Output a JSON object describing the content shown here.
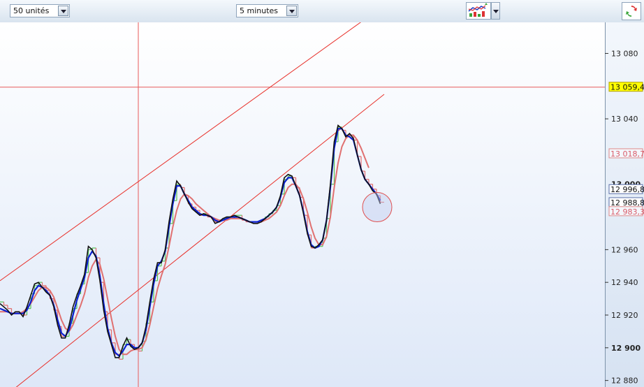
{
  "toolbar": {
    "units_select": "50 unités",
    "interval_select": "5 minutes",
    "tool_icon": "chart-tools-icon",
    "corner_icon": "refresh-arrows-icon"
  },
  "colors": {
    "up_bar": "#55c255",
    "down_bar": "#e06a6a",
    "fast_ma": "#0a1fd0",
    "price_line": "#111111",
    "slow_ma": "#e07070",
    "trendline": "#e8302a",
    "crosshair": "#e85a5a",
    "price_highlight": "#ffff00"
  },
  "chart_data": {
    "type": "line",
    "instrument_units": "50 unités",
    "interval": "5 minutes",
    "ylim": [
      12876,
      13099
    ],
    "y_ticks": [
      {
        "value": 13080,
        "label": "13 080",
        "major": false
      },
      {
        "value": 13040,
        "label": "13 040",
        "major": false
      },
      {
        "value": 12960,
        "label": "12 960",
        "major": false
      },
      {
        "value": 12940,
        "label": "12 940",
        "major": false
      },
      {
        "value": 12920,
        "label": "12 920",
        "major": false
      },
      {
        "value": 12900,
        "label": "12 900",
        "major": true
      },
      {
        "value": 12880,
        "label": "12 880",
        "major": false
      }
    ],
    "partial_tick": {
      "value": 13000,
      "label": "13 000"
    },
    "price_tags": [
      {
        "value": 13059.4,
        "label": "13 059,4",
        "style": "highlight"
      },
      {
        "value": 13018.7,
        "label": "13 018,7",
        "style": "pink"
      },
      {
        "value": 12996.8,
        "label": "12 996,8",
        "style": "blue"
      },
      {
        "value": 12988.8,
        "label": "12 988,8",
        "style": "blue"
      },
      {
        "value": 12983.3,
        "label": "12 983,3",
        "style": "pink"
      }
    ],
    "crosshair": {
      "bar": 36,
      "value": 13059.4
    },
    "price_series": [
      12927,
      12925,
      12923,
      12920,
      12922,
      12922,
      12919,
      12925,
      12932,
      12939,
      12940,
      12937,
      12934,
      12932,
      12925,
      12914,
      12906,
      12906,
      12914,
      12925,
      12932,
      12938,
      12945,
      12962,
      12960,
      12955,
      12941,
      12923,
      12910,
      12902,
      12894,
      12894,
      12901,
      12906,
      12901,
      12899,
      12900,
      12903,
      12913,
      12928,
      12942,
      12952,
      12952,
      12960,
      12977,
      12991,
      13002,
      12999,
      12994,
      12989,
      12985,
      12983,
      12981,
      12982,
      12981,
      12980,
      12976,
      12977,
      12979,
      12980,
      12980,
      12981,
      12980,
      12979,
      12978,
      12977,
      12976,
      12976,
      12977,
      12979,
      12981,
      12983,
      12986,
      12993,
      13004,
      13006,
      13005,
      12999,
      12993,
      12982,
      12970,
      12962,
      12961,
      12963,
      12966,
      12978,
      13000,
      13026,
      13036,
      13034,
      13029,
      13031,
      13028,
      13018,
      13009,
      13003,
      13000,
      12996,
      12994,
      12988
    ],
    "series": [
      {
        "name": "",
        "type": "bars",
        "values": [
          12928,
          12926,
          12924,
          12921,
          12921,
          12921,
          12920,
          12924,
          12933,
          12938,
          12940,
          12938,
          12935,
          12930,
          12923,
          12913,
          12907,
          12907,
          12915,
          12924,
          12933,
          12939,
          12946,
          12960,
          12961,
          12955,
          12940,
          12922,
          12911,
          12903,
          12896,
          12893,
          12902,
          12905,
          12902,
          12899,
          12898,
          12904,
          12915,
          12928,
          12941,
          12950,
          12953,
          12961,
          12976,
          12990,
          13000,
          12998,
          12993,
          12988,
          12986,
          12984,
          12981,
          12982,
          12980,
          12979,
          12977,
          12978,
          12979,
          12980,
          12979,
          12981,
          12981,
          12978,
          12977,
          12977,
          12977,
          12977,
          12978,
          12980,
          12982,
          12984,
          12987,
          12994,
          13003,
          13005,
          13004,
          12998,
          12992,
          12981,
          12969,
          12961,
          12962,
          12962,
          12967,
          12979,
          13000,
          13026,
          13035,
          13033,
          13029,
          13030,
          13027,
          13017,
          13008,
          13003,
          13000,
          12997,
          12993,
          12989
        ]
      },
      {
        "name": "",
        "type": "fast_ma",
        "values": [
          12924,
          12923,
          12922,
          12921,
          12921,
          12921,
          12921,
          12923,
          12928,
          12935,
          12938,
          12937,
          12935,
          12932,
          12926,
          12917,
          12909,
          12907,
          12911,
          12920,
          12929,
          12936,
          12943,
          12955,
          12959,
          12956,
          12944,
          12927,
          12912,
          12903,
          12897,
          12895,
          12898,
          12902,
          12902,
          12900,
          12900,
          12903,
          12911,
          12925,
          12939,
          12950,
          12953,
          12959,
          12974,
          12988,
          12999,
          12999,
          12994,
          12990,
          12986,
          12984,
          12982,
          12981,
          12981,
          12980,
          12978,
          12977,
          12978,
          12979,
          12980,
          12980,
          12980,
          12979,
          12978,
          12977,
          12977,
          12977,
          12978,
          12979,
          12981,
          12983,
          12986,
          12992,
          13001,
          13004,
          13004,
          12999,
          12993,
          12983,
          12971,
          12963,
          12961,
          12962,
          12966,
          12978,
          12998,
          13022,
          13034,
          13034,
          13030,
          13029,
          13027,
          13018,
          13009,
          13003,
          13000,
          12997,
          12994,
          12990
        ]
      },
      {
        "name": "",
        "type": "slow_ma",
        "values": [
          12922,
          12922,
          12922,
          12921,
          12921,
          12921,
          12922,
          12924,
          12927,
          12931,
          12935,
          12937,
          12937,
          12935,
          12931,
          12924,
          12917,
          12912,
          12910,
          12914,
          12920,
          12926,
          12933,
          12943,
          12950,
          12954,
          12951,
          12942,
          12930,
          12918,
          12907,
          12899,
          12896,
          12896,
          12898,
          12899,
          12899,
          12900,
          12905,
          12914,
          12925,
          12936,
          12944,
          12951,
          12962,
          12974,
          12984,
          12991,
          12994,
          12993,
          12991,
          12988,
          12986,
          12984,
          12982,
          12980,
          12979,
          12978,
          12978,
          12978,
          12979,
          12979,
          12979,
          12979,
          12978,
          12977,
          12977,
          12977,
          12977,
          12978,
          12979,
          12981,
          12983,
          12987,
          12993,
          12998,
          13000,
          13000,
          12997,
          12991,
          12983,
          12974,
          12967,
          12963,
          12963,
          12968,
          12980,
          12998,
          13013,
          13023,
          13028,
          13030,
          13030,
          13027,
          13022,
          13016,
          13010
        ]
      }
    ],
    "trendlines": [
      {
        "from": [
          0,
          12941
        ],
        "to": [
          98,
          13106
        ]
      },
      {
        "from": [
          0,
          12868
        ],
        "to": [
          100,
          13055
        ]
      }
    ],
    "annotation": {
      "type": "circle",
      "bar": 98,
      "value": 12986
    }
  }
}
